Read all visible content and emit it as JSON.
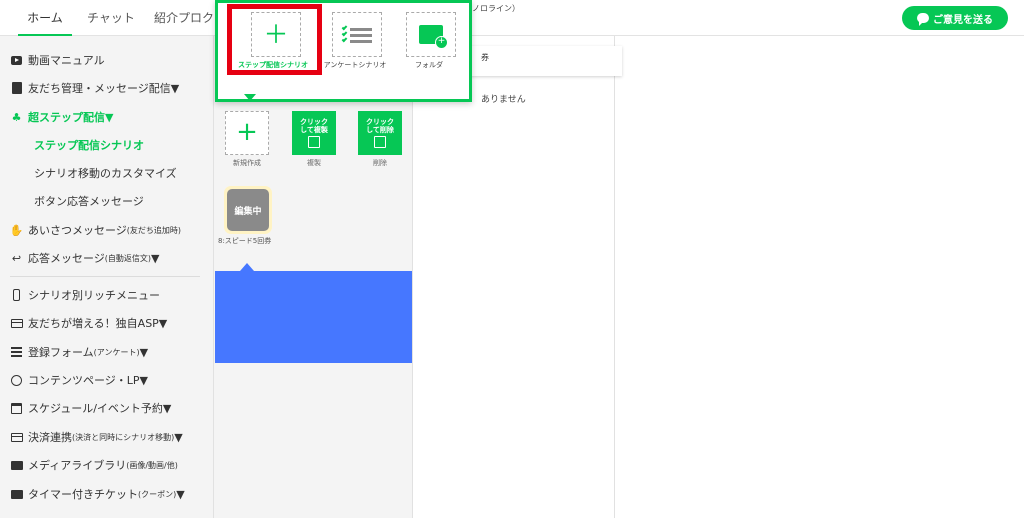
{
  "topbar": {
    "tabs": [
      {
        "label": "ホーム"
      },
      {
        "label": "チャット"
      },
      {
        "label": "紹介プロク"
      }
    ],
    "partial_text": "ノロライン）",
    "feedback_label": "ご意見を送る"
  },
  "sidebar": {
    "items": [
      {
        "label": "動画マニュアル"
      },
      {
        "label": "友だち管理・メッセージ配信▼"
      },
      {
        "label": "超ステップ配信▼"
      },
      {
        "label": "ステップ配信シナリオ"
      },
      {
        "label": "シナリオ移動のカスタマイズ"
      },
      {
        "label": "ボタン応答メッセージ"
      },
      {
        "label": "あいさつメッセージ",
        "small": "(友だち追加時)"
      },
      {
        "label": "応答メッセージ",
        "small": "(自動返信文)",
        "suffix": "▼"
      },
      {
        "label": "シナリオ別リッチメニュー"
      },
      {
        "label": "友だちが増える！独自ASP▼"
      },
      {
        "label": "登録フォーム",
        "small": "(アンケート)",
        "suffix": "▼"
      },
      {
        "label": "コンテンツページ・LP▼"
      },
      {
        "label": "スケジュール/イベント予約▼"
      },
      {
        "label": "決済連携",
        "small": "(決済と同時にシナリオ移動)",
        "suffix": "▼"
      },
      {
        "label": "メディアライブラリ",
        "small": "(画像/動画/他)"
      },
      {
        "label": "タイマー付きチケット",
        "small": "(クーポン)",
        "suffix": "▼"
      }
    ]
  },
  "popup": {
    "options": [
      {
        "label": "ステップ配信シナリオ",
        "icon": "plus-icon"
      },
      {
        "label": "アンケートシナリオ",
        "icon": "checklist-icon"
      },
      {
        "label": "フォルダ",
        "icon": "folder-add-icon"
      }
    ]
  },
  "actions": [
    {
      "label": "新規作成",
      "text": "+"
    },
    {
      "label": "複製",
      "text_line1": "クリック",
      "text_line2": "して複製"
    },
    {
      "label": "削除",
      "text_line1": "クリック",
      "text_line2": "して削除"
    }
  ],
  "scenario": {
    "badge": "編集中",
    "name": "8:スピード5回券"
  },
  "detail": {
    "card_text": "券",
    "empty_text": "ありません"
  },
  "colors": {
    "accent": "#06c755",
    "highlight": "#e60012",
    "blue": "#4677ff"
  }
}
